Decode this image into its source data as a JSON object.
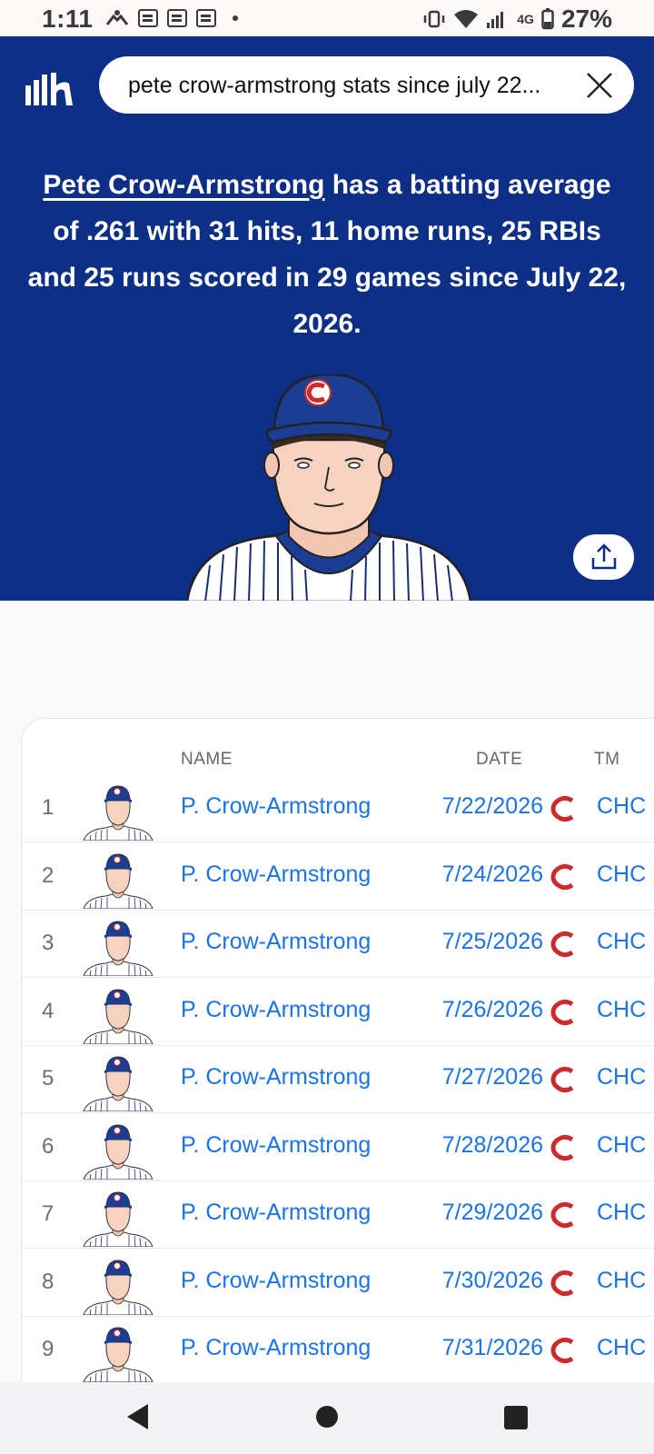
{
  "status_bar": {
    "time": "1:11",
    "network": "4G",
    "battery": "27%"
  },
  "search": {
    "query": "pete crow-armstrong stats since july 22..."
  },
  "summary": {
    "player_link": "Pete Crow-Armstrong",
    "text": " has a batting average of .261 with 31 hits, 11 home runs, 25 RBIs and 25 runs scored in 29 games since July 22, 2026."
  },
  "table": {
    "headers": {
      "name": "NAME",
      "date": "DATE",
      "team": "TM"
    },
    "rows": [
      {
        "num": "1",
        "name": "P. Crow-Armstrong",
        "date": "7/22/2026",
        "team": "CHC"
      },
      {
        "num": "2",
        "name": "P. Crow-Armstrong",
        "date": "7/24/2026",
        "team": "CHC"
      },
      {
        "num": "3",
        "name": "P. Crow-Armstrong",
        "date": "7/25/2026",
        "team": "CHC"
      },
      {
        "num": "4",
        "name": "P. Crow-Armstrong",
        "date": "7/26/2026",
        "team": "CHC"
      },
      {
        "num": "5",
        "name": "P. Crow-Armstrong",
        "date": "7/27/2026",
        "team": "CHC"
      },
      {
        "num": "6",
        "name": "P. Crow-Armstrong",
        "date": "7/28/2026",
        "team": "CHC"
      },
      {
        "num": "7",
        "name": "P. Crow-Armstrong",
        "date": "7/29/2026",
        "team": "CHC"
      },
      {
        "num": "8",
        "name": "P. Crow-Armstrong",
        "date": "7/30/2026",
        "team": "CHC"
      },
      {
        "num": "9",
        "name": "P. Crow-Armstrong",
        "date": "7/31/2026",
        "team": "CHC"
      }
    ]
  },
  "colors": {
    "brand_blue": "#0d2f86",
    "link_blue": "#1a73e8",
    "cubs_red": "#cc2b2b"
  }
}
